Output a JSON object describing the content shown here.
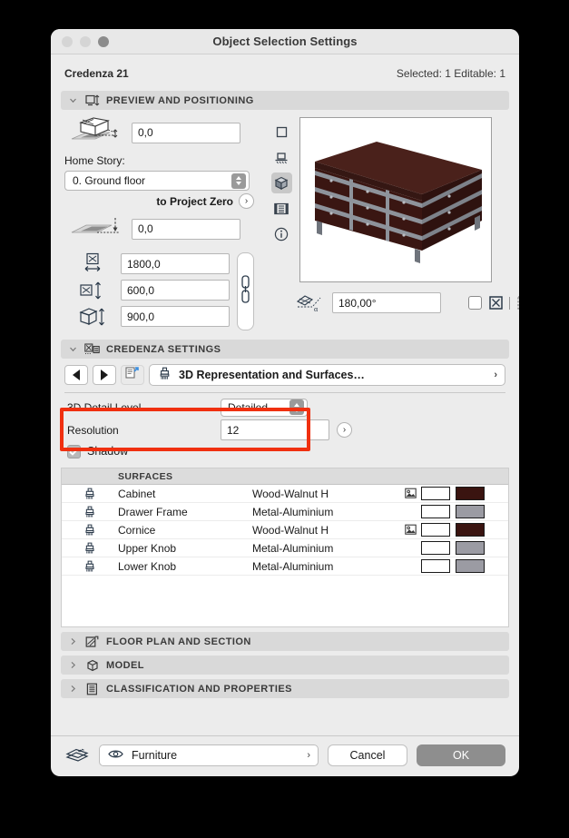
{
  "window": {
    "title": "Object Selection Settings",
    "traffic_lights": [
      "close-button",
      "minimize-button",
      "zoom-button"
    ]
  },
  "header": {
    "object_name": "Credenza 21",
    "selection_info": "Selected: 1 Editable: 1"
  },
  "sections": {
    "preview": {
      "label": "PREVIEW AND POSITIONING",
      "icon": "preview-positioning-icon",
      "expanded": true
    },
    "credenza": {
      "label": "CREDENZA SETTINGS",
      "icon": "credenza-settings-icon",
      "expanded": true
    },
    "floorplan": {
      "label": "FLOOR PLAN AND SECTION",
      "icon": "floor-plan-icon",
      "expanded": false
    },
    "model": {
      "label": "MODEL",
      "icon": "model-cube-icon",
      "expanded": false
    },
    "classification": {
      "label": "CLASSIFICATION AND PROPERTIES",
      "icon": "document-list-icon",
      "expanded": false
    }
  },
  "positioning": {
    "elevation_to_story": "0,0",
    "home_story_label": "Home Story:",
    "home_story_value": "0. Ground floor",
    "project_zero_label": "to Project Zero",
    "elevation_to_project_zero": "0,0",
    "width": "1800,0",
    "depth": "600,0",
    "height": "900,0",
    "link_state": "linked"
  },
  "preview_panel": {
    "tools": [
      {
        "name": "symbol-2d-icon",
        "selected": false
      },
      {
        "name": "elevation-view-icon",
        "selected": false
      },
      {
        "name": "3d-view-icon",
        "selected": true
      },
      {
        "name": "list-preview-icon",
        "selected": false
      },
      {
        "name": "info-icon",
        "selected": false
      }
    ],
    "model_alt": "3D preview of dark walnut credenza with aluminium drawer frames",
    "angle_value": "180,00°",
    "angle_icon": "rotation-angle-icon",
    "mirror_checkbox": false,
    "anchor_buttons": [
      "anchor-fixed-icon",
      "anchor-free-icon"
    ]
  },
  "credenza_settings": {
    "prev_label": "◀",
    "next_label": "▶",
    "page_icon": "page-jump-icon",
    "picker_icon": "brush-icon",
    "picker_label": "3D Representation and Surfaces…",
    "picker_chevron": "›",
    "detail_level_label": "3D Detail Level",
    "detail_level_value": "Detailed",
    "resolution_label": "Resolution",
    "resolution_value": "12",
    "resolution_more": "›",
    "shadow_label": "Shadow",
    "shadow_checked": true,
    "highlight_color": "#f03010"
  },
  "surfaces_table": {
    "header": "SURFACES",
    "rows": [
      {
        "icon": "brush-icon",
        "name": "Cabinet",
        "material": "Wood-Walnut H",
        "has_texture": true,
        "swatch": "#3a1410"
      },
      {
        "icon": "brush-icon",
        "name": "Drawer Frame",
        "material": "Metal-Aluminium",
        "has_texture": false,
        "swatch": "#9b9ba3"
      },
      {
        "icon": "brush-icon",
        "name": "Cornice",
        "material": "Wood-Walnut H",
        "has_texture": true,
        "swatch": "#3a1410"
      },
      {
        "icon": "brush-icon",
        "name": "Upper Knob",
        "material": "Metal-Aluminium",
        "has_texture": false,
        "swatch": "#9b9ba3"
      },
      {
        "icon": "brush-icon",
        "name": "Lower Knob",
        "material": "Metal-Aluminium",
        "has_texture": false,
        "swatch": "#9b9ba3"
      }
    ]
  },
  "footer": {
    "layer_icon": "layers-icon",
    "eye_icon": "eye-icon",
    "layer_value": "Furniture",
    "layer_chevron": "›",
    "cancel_label": "Cancel",
    "ok_label": "OK"
  }
}
